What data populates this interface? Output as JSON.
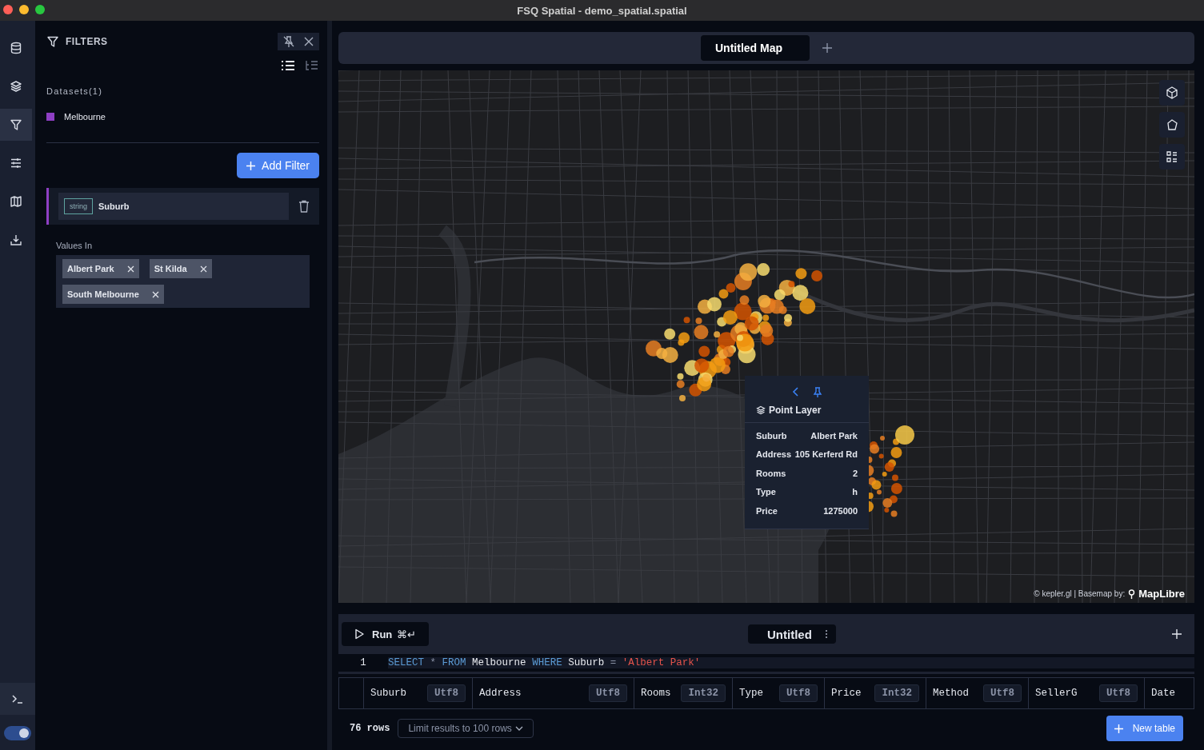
{
  "window": {
    "title": "FSQ Spatial - demo_spatial.spatial"
  },
  "rail": [
    {
      "kind": "database",
      "selected": false
    },
    {
      "kind": "layers",
      "selected": false
    },
    {
      "kind": "filter",
      "selected": true
    },
    {
      "kind": "sliders",
      "selected": false
    },
    {
      "kind": "map",
      "selected": false
    },
    {
      "kind": "download",
      "selected": false
    }
  ],
  "theme_toggle": {
    "on": true
  },
  "filters_panel": {
    "title": "FILTERS",
    "datasets_label": "Datasets(1)",
    "datasets": [
      {
        "name": "Melbourne",
        "color": "#8e3fc4"
      }
    ],
    "add_button": "Add Filter",
    "filter": {
      "type": "string",
      "field": "Suburb",
      "values_label": "Values In",
      "values": [
        "Albert Park",
        "St Kilda",
        "South Melbourne"
      ]
    }
  },
  "map_tabs": [
    {
      "label": "Untitled Map",
      "selected": true
    }
  ],
  "map": {
    "attribution": "© kepler.gl | Basemap by:",
    "brand": "MapLibre",
    "tooltip": {
      "layer": "Point Layer",
      "rows": [
        {
          "label": "Suburb",
          "value": "Albert Park"
        },
        {
          "label": "Address",
          "value": "105 Kerferd Rd"
        },
        {
          "label": "Rooms",
          "value": "2"
        },
        {
          "label": "Type",
          "value": "h"
        },
        {
          "label": "Price",
          "value": "1275000"
        }
      ]
    }
  },
  "sql": {
    "run": "Run",
    "shortcut": "⌘↵",
    "tab": "Untitled",
    "line_number": "1",
    "query": [
      {
        "kind": "keyword",
        "text": "SELECT"
      },
      {
        "kind": "op",
        "text": "*"
      },
      {
        "kind": "keyword",
        "text": "FROM"
      },
      {
        "kind": "ident",
        "text": "Melbourne"
      },
      {
        "kind": "keyword",
        "text": "WHERE"
      },
      {
        "kind": "ident",
        "text": "Suburb"
      },
      {
        "kind": "op",
        "text": "="
      },
      {
        "kind": "string",
        "text": "'Albert Park'"
      }
    ],
    "columns": [
      {
        "name": "Suburb",
        "type": "Utf8"
      },
      {
        "name": "Address",
        "type": "Utf8"
      },
      {
        "name": "Rooms",
        "type": "Int32"
      },
      {
        "name": "Type",
        "type": "Utf8"
      },
      {
        "name": "Price",
        "type": "Int32"
      },
      {
        "name": "Method",
        "type": "Utf8"
      },
      {
        "name": "SellerG",
        "type": "Utf8"
      },
      {
        "name": "Date"
      }
    ],
    "row_count": "76 rows",
    "limit": "Limit results to 100 rows",
    "new_table": "New table"
  }
}
